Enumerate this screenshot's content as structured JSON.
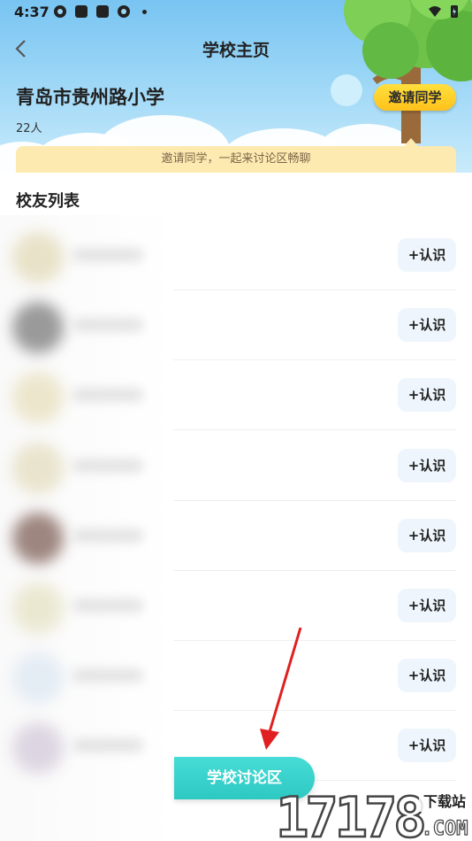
{
  "status_bar": {
    "time": "4:37"
  },
  "header": {
    "title": "学校主页",
    "school_name": "青岛市贵州路小学",
    "member_count": "22人",
    "invite_button": "邀请同学",
    "tip": "邀请同学，一起来讨论区畅聊"
  },
  "section": {
    "title": "校友列表"
  },
  "alumni": [
    {
      "action": "+认识"
    },
    {
      "action": "+认识"
    },
    {
      "action": "+认识"
    },
    {
      "action": "+认识"
    },
    {
      "action": "+认识"
    },
    {
      "action": "+认识"
    },
    {
      "action": "+认识"
    },
    {
      "action": "+认识"
    }
  ],
  "floating": {
    "discuss_button": "学校讨论区"
  },
  "watermark": {
    "number": "17178",
    "site_cn": "下载站",
    "site_en": ".COM"
  },
  "colors": {
    "accent_yellow": "#ffc21a",
    "discuss_teal": "#2ec8c2",
    "tip_bg": "#fdeab1",
    "arrow_red": "#e02020"
  }
}
